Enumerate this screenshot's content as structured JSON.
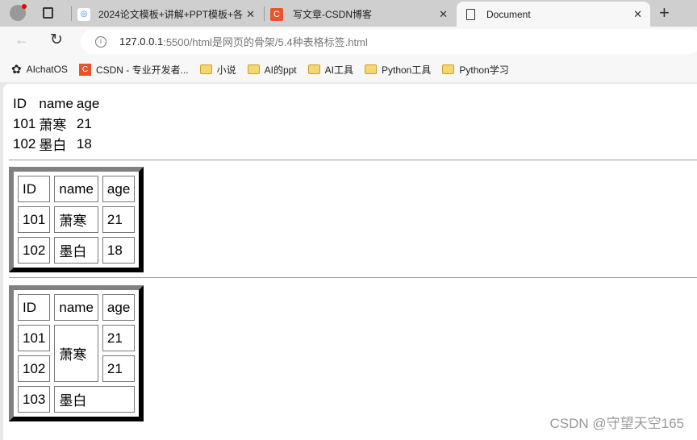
{
  "browser": {
    "tabs": [
      {
        "label": "2024论文模板+讲解+PPT模板+各",
        "icon": "baidu-cloud-icon"
      },
      {
        "label": "写文章-CSDN博客",
        "icon": "csdn-icon"
      },
      {
        "label": "Document",
        "icon": "document-icon",
        "active": true
      }
    ],
    "url_host": "127.0.0.1",
    "url_rest": ":5500/html是网页的骨架/5.4种表格标签.html",
    "bookmarks": [
      {
        "label": "AIchatOS",
        "icon": "openai-icon"
      },
      {
        "label": "CSDN - 专业开发者...",
        "icon": "csdn-icon"
      },
      {
        "label": "小说",
        "icon": "folder-icon"
      },
      {
        "label": "AI的ppt",
        "icon": "folder-icon"
      },
      {
        "label": "AI工具",
        "icon": "folder-icon"
      },
      {
        "label": "Python工具",
        "icon": "folder-icon"
      },
      {
        "label": "Python学习",
        "icon": "folder-icon"
      }
    ]
  },
  "table1": {
    "rows": [
      [
        "ID",
        "name",
        "age"
      ],
      [
        "101",
        "萧寒",
        "21"
      ],
      [
        "102",
        "墨白",
        "18"
      ]
    ]
  },
  "table2": {
    "rows": [
      [
        "ID",
        "name",
        "age"
      ],
      [
        "101",
        "萧寒",
        "21"
      ],
      [
        "102",
        "墨白",
        "18"
      ]
    ]
  },
  "table3": {
    "header": [
      "ID",
      "name",
      "age"
    ],
    "r1": [
      "101",
      "萧寒",
      "21"
    ],
    "r2": [
      "102",
      "21"
    ],
    "r3": [
      "103",
      "墨白"
    ]
  },
  "watermark": "CSDN @守望天空165"
}
